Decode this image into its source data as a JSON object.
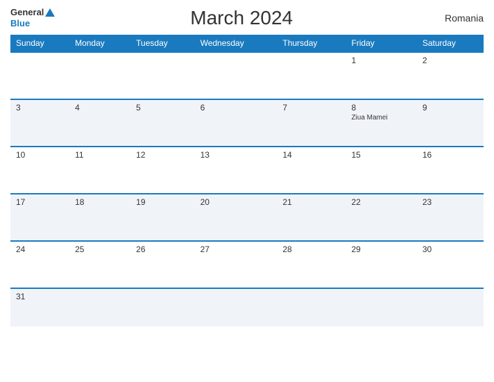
{
  "header": {
    "title": "March 2024",
    "country": "Romania",
    "logo_general": "General",
    "logo_blue": "Blue"
  },
  "days_of_week": [
    "Sunday",
    "Monday",
    "Tuesday",
    "Wednesday",
    "Thursday",
    "Friday",
    "Saturday"
  ],
  "weeks": [
    [
      {
        "date": "",
        "event": ""
      },
      {
        "date": "",
        "event": ""
      },
      {
        "date": "",
        "event": ""
      },
      {
        "date": "",
        "event": ""
      },
      {
        "date": "",
        "event": ""
      },
      {
        "date": "1",
        "event": ""
      },
      {
        "date": "2",
        "event": ""
      }
    ],
    [
      {
        "date": "3",
        "event": ""
      },
      {
        "date": "4",
        "event": ""
      },
      {
        "date": "5",
        "event": ""
      },
      {
        "date": "6",
        "event": ""
      },
      {
        "date": "7",
        "event": ""
      },
      {
        "date": "8",
        "event": "Ziua Mamei"
      },
      {
        "date": "9",
        "event": ""
      }
    ],
    [
      {
        "date": "10",
        "event": ""
      },
      {
        "date": "11",
        "event": ""
      },
      {
        "date": "12",
        "event": ""
      },
      {
        "date": "13",
        "event": ""
      },
      {
        "date": "14",
        "event": ""
      },
      {
        "date": "15",
        "event": ""
      },
      {
        "date": "16",
        "event": ""
      }
    ],
    [
      {
        "date": "17",
        "event": ""
      },
      {
        "date": "18",
        "event": ""
      },
      {
        "date": "19",
        "event": ""
      },
      {
        "date": "20",
        "event": ""
      },
      {
        "date": "21",
        "event": ""
      },
      {
        "date": "22",
        "event": ""
      },
      {
        "date": "23",
        "event": ""
      }
    ],
    [
      {
        "date": "24",
        "event": ""
      },
      {
        "date": "25",
        "event": ""
      },
      {
        "date": "26",
        "event": ""
      },
      {
        "date": "27",
        "event": ""
      },
      {
        "date": "28",
        "event": ""
      },
      {
        "date": "29",
        "event": ""
      },
      {
        "date": "30",
        "event": ""
      }
    ],
    [
      {
        "date": "31",
        "event": ""
      },
      {
        "date": "",
        "event": ""
      },
      {
        "date": "",
        "event": ""
      },
      {
        "date": "",
        "event": ""
      },
      {
        "date": "",
        "event": ""
      },
      {
        "date": "",
        "event": ""
      },
      {
        "date": "",
        "event": ""
      }
    ]
  ]
}
